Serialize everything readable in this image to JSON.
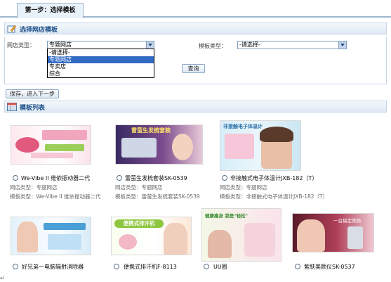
{
  "tabs": {
    "step1": "第一步：选择模板"
  },
  "select_section": {
    "title": "选择网店模板"
  },
  "form": {
    "shop_type_label": "网店类型：",
    "shop_type_value": "专题网店",
    "shop_type_options": [
      "-请选择-",
      "专题网店",
      "专卖店",
      "综合"
    ],
    "template_type_label": "模板类型：",
    "template_type_value": "-请选择-",
    "query_label": "查询",
    "save_next_label": "保存，进入下一步"
  },
  "list_section": {
    "title": "模板列表"
  },
  "row1": [
    {
      "name": "We-Vibe II 维依振动器二代",
      "shop": "网店类型：专题网店",
      "tpl": "模板类型：We-Vibe II 维依振动器二代"
    },
    {
      "name": "雷萤生发梳套装SK-0539",
      "shop": "网店类型：专题网店",
      "tpl": "模板类型：雷萤生发梳套装SK-0539"
    },
    {
      "name": "非接触式电子体温计JXB-182（T）",
      "shop": "网店类型：专题网店",
      "tpl": "模板类型：非接触式电子体温计JXB-182（T）"
    }
  ],
  "row2": [
    {
      "name": "好兄弟一电脑辐射消除器"
    },
    {
      "name": "便携式排汗机F-8113"
    },
    {
      "name": "UU圈"
    },
    {
      "name": "紫肤美颜仪SK-0537"
    }
  ],
  "thumb_text": {
    "t2": "雷萤生发梳套装",
    "t3": "非接触电子体温计",
    "t5": "便携式排汗机",
    "t6": "健康痩身 我是\"轻松\"",
    "t7": "一台搞定美颜"
  },
  "colors": {
    "accent": "#1c4f8a",
    "selected": "#316ac5",
    "border": "#c5d6e6"
  },
  "paragraph_mark": "↵"
}
